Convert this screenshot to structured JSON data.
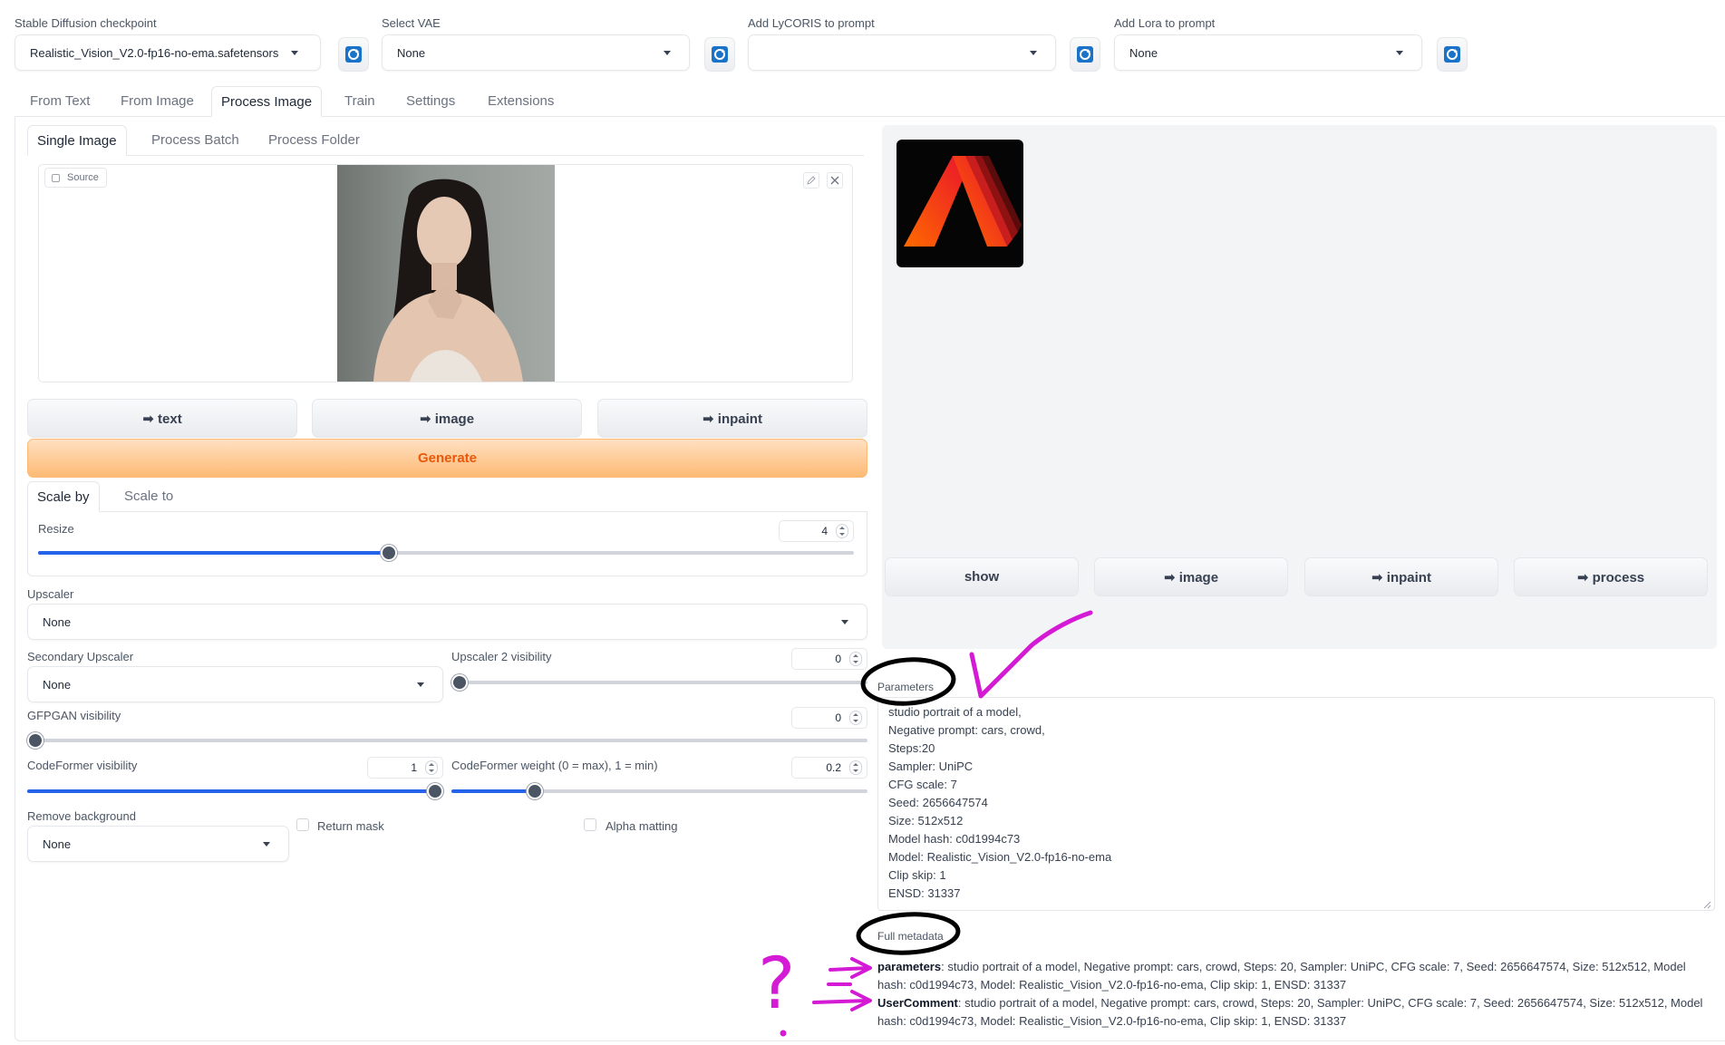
{
  "top": {
    "checkpoint": {
      "label": "Stable Diffusion checkpoint",
      "value": "Realistic_Vision_V2.0-fp16-no-ema.safetensors"
    },
    "vae": {
      "label": "Select VAE",
      "value": "None"
    },
    "lycoris": {
      "label": "Add LyCORIS to prompt",
      "value": ""
    },
    "lora": {
      "label": "Add Lora to prompt",
      "value": "None"
    }
  },
  "main_tabs": [
    "From Text",
    "From Image",
    "Process Image",
    "Train",
    "Settings",
    "Extensions"
  ],
  "sub_tabs": [
    "Single Image",
    "Process Batch",
    "Process Folder"
  ],
  "source_label": "Source",
  "left_buttons": {
    "text": "➡ text",
    "image": "➡ image",
    "inpaint": "➡ inpaint",
    "generate": "Generate"
  },
  "scale_tabs": [
    "Scale by",
    "Scale to"
  ],
  "resize": {
    "label": "Resize",
    "value": "4",
    "fraction": 0.43
  },
  "upscaler": {
    "label": "Upscaler",
    "value": "None"
  },
  "secondary_upscaler": {
    "label": "Secondary Upscaler",
    "value": "None"
  },
  "upscaler2_visibility": {
    "label": "Upscaler 2 visibility",
    "value": "0",
    "fraction": 0.0
  },
  "gfpgan": {
    "label": "GFPGAN visibility",
    "value": "0",
    "fraction": 0.0
  },
  "codeformer_visibility": {
    "label": "CodeFormer visibility",
    "value": "1",
    "fraction": 1.0
  },
  "codeformer_weight": {
    "label": "CodeFormer weight (0 = max), 1 = min)",
    "value": "0.2",
    "fraction": 0.2
  },
  "remove_background": {
    "label": "Remove background",
    "value": "None"
  },
  "return_mask": "Return mask",
  "alpha_matting": "Alpha matting",
  "right_buttons": {
    "show": "show",
    "image": "➡ image",
    "inpaint": "➡ inpaint",
    "process": "➡ process"
  },
  "parameters": {
    "label": "Parameters",
    "lines": [
      "studio portrait of a model,",
      "Negative prompt: cars, crowd,",
      "Steps:20",
      "Sampler: UniPC",
      "CFG scale: 7",
      "Seed: 2656647574",
      "Size: 512x512",
      "Model hash: c0d1994c73",
      "Model: Realistic_Vision_V2.0-fp16-no-ema",
      "Clip skip: 1",
      "ENSD: 31337"
    ]
  },
  "full_metadata": {
    "label": "Full metadata",
    "parameters_key": "parameters",
    "parameters_value": ": studio portrait of a model, Negative prompt: cars, crowd, Steps: 20, Sampler: UniPC, CFG scale: 7, Seed: 2656647574, Size: 512x512, Model hash: c0d1994c73, Model: Realistic_Vision_V2.0-fp16-no-ema, Clip skip: 1, ENSD: 31337",
    "usercomment_key": "UserComment",
    "usercomment_value": ": studio portrait of a model, Negative prompt: cars, crowd, Steps: 20, Sampler: UniPC, CFG scale: 7, Seed: 2656647574, Size: 512x512, Model hash: c0d1994c73, Model: Realistic_Vision_V2.0-fp16-no-ema, Clip skip: 1, ENSD: 31337"
  },
  "annotation": {
    "question_mark": "?"
  },
  "colors": {
    "accent": "#2563eb",
    "generate": "#fdba74",
    "annotation_purple": "#d41ad4"
  }
}
